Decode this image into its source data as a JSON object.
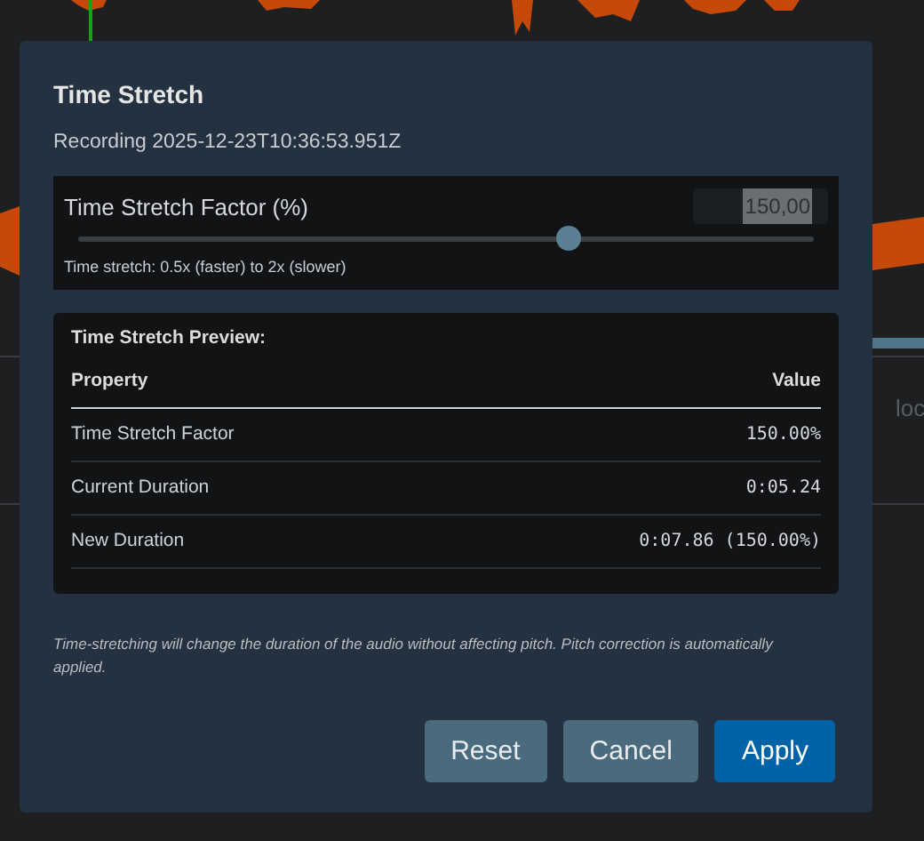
{
  "background": {
    "label": "loc"
  },
  "dialog": {
    "title": "Time Stretch",
    "subtitle": "Recording 2025-12-23T10:36:53.951Z",
    "factor": {
      "label": "Time Stretch Factor (%)",
      "value": "150,00",
      "level": 0.667,
      "hint": "Time stretch: 0.5x (faster) to 2x (slower)"
    },
    "preview": {
      "title": "Time Stretch Preview:",
      "columns": [
        "Property",
        "Value"
      ],
      "rows": [
        {
          "property": "Time Stretch Factor",
          "value": "150.00%"
        },
        {
          "property": "Current Duration",
          "value": "0:05.24"
        },
        {
          "property": "New Duration",
          "value": "0:07.86 (150.00%)"
        }
      ]
    },
    "note": "Time-stretching will change the duration of the audio without affecting pitch. Pitch correction is automatically applied.",
    "buttons": [
      {
        "label": "Reset",
        "kind": "secondary"
      },
      {
        "label": "Cancel",
        "kind": "secondary"
      },
      {
        "label": "Apply",
        "kind": "primary"
      }
    ]
  }
}
